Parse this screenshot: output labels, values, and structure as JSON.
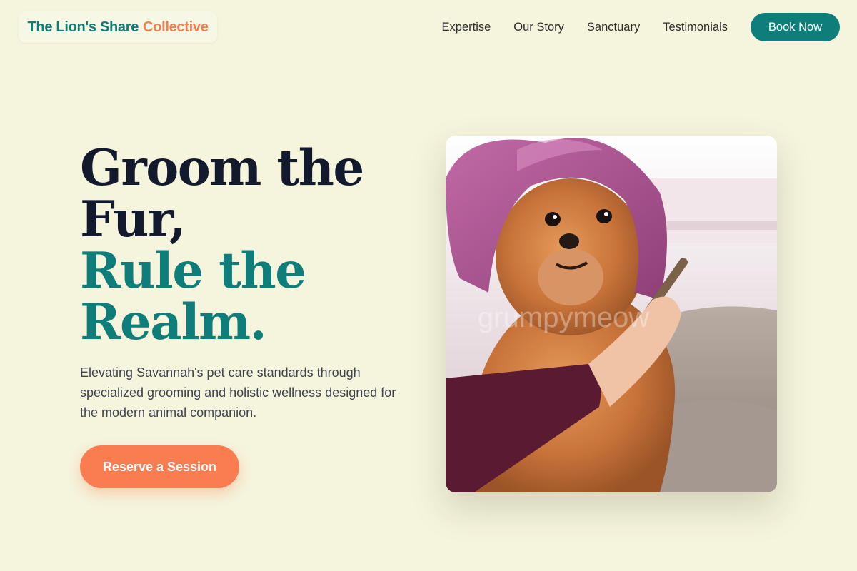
{
  "brand": {
    "name_primary": "The Lion's Share",
    "name_accent": "Collective"
  },
  "nav": {
    "links": [
      "Expertise",
      "Our Story",
      "Sanctuary",
      "Testimonials"
    ],
    "cta_label": "Book Now"
  },
  "hero": {
    "headline_line1": "Groom the",
    "headline_line2": "Fur,",
    "headline_line3": "Rule the",
    "headline_line4": "Realm.",
    "description": "Elevating Savannah's pet care standards through specialized grooming and holistic wellness designed for the modern animal companion.",
    "cta_label": "Reserve a Session",
    "image_watermark": "grumpymeow"
  },
  "colors": {
    "background": "#f5f4dc",
    "teal": "#0f7e7b",
    "coral": "#fa7d52",
    "dark_text": "#141a2e"
  },
  "icons": {
    "hero_image": "dog-grooming-photo"
  }
}
